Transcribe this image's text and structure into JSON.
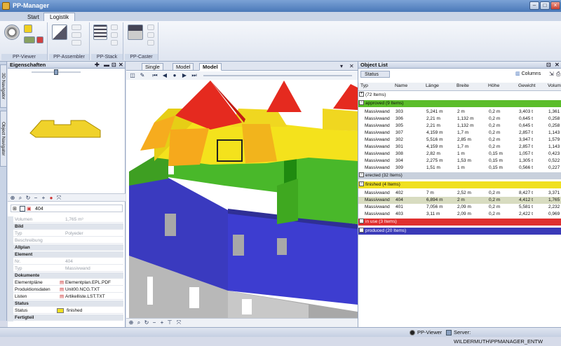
{
  "window": {
    "title": "PP-Manager"
  },
  "ribbon": {
    "tabs": [
      "Start",
      "Logistik"
    ],
    "groups": [
      "PP-Viewer",
      "PP-Assembler",
      "PP-Stack",
      "PP-Caster"
    ]
  },
  "side_tabs": [
    "3D Navigator",
    "Object Navigator"
  ],
  "properties": {
    "title": "Eigenschaften",
    "tree_item": "404",
    "rows": [
      {
        "k": "Volumen",
        "v": "1,765 m³",
        "type": "dim"
      },
      {
        "k": "Bild",
        "v": "",
        "type": "cat"
      },
      {
        "k": "Typ",
        "v": "Polyeder",
        "type": "dim"
      },
      {
        "k": "Beschreibung",
        "v": "",
        "type": "dim"
      },
      {
        "k": "Allplan",
        "v": "",
        "type": "cat"
      },
      {
        "k": "Element",
        "v": "",
        "type": "cat"
      },
      {
        "k": "Nr.",
        "v": "404",
        "type": "dim"
      },
      {
        "k": "Typ",
        "v": "Massivwand",
        "type": "dim"
      },
      {
        "k": "Dokumente",
        "v": "",
        "type": "cat"
      },
      {
        "k": "Elementpläne",
        "v": "Elementplan.EPL.PDF",
        "type": "doc"
      },
      {
        "k": "Produktionsdaten",
        "v": "Unit00.NCG.TXT",
        "type": "doc"
      },
      {
        "k": "Listen",
        "v": "Artikelliste.LST.TXT",
        "type": "doc"
      },
      {
        "k": "Status",
        "v": "",
        "type": "cat"
      },
      {
        "k": "Status",
        "v": "finished",
        "type": "status"
      },
      {
        "k": "Fertigteil",
        "v": "",
        "type": "cat"
      }
    ]
  },
  "viewer": {
    "tabs": [
      "Single",
      "Model",
      "Model"
    ]
  },
  "object_list": {
    "title": "Object List",
    "group_by": "Status",
    "columns_btn": "Columns",
    "headers": [
      "Typ",
      "Name",
      "Länge",
      "Breite",
      "Höhe",
      "Gewicht",
      "Volum"
    ],
    "total": "(72 Items)",
    "groups": [
      {
        "label": "approved (9 Items)",
        "color": "#5bbd2a",
        "rows": [
          [
            "Massivwand",
            "303",
            "5,241 m",
            "2 m",
            "0,2 m",
            "3,403 t",
            "1,361"
          ],
          [
            "Massivwand",
            "306",
            "2,21 m",
            "1,132 m",
            "0,2 m",
            "0,645 t",
            "0,258"
          ],
          [
            "Massivwand",
            "305",
            "2,21 m",
            "1,132 m",
            "0,2 m",
            "0,645 t",
            "0,258"
          ],
          [
            "Massivwand",
            "307",
            "4,159 m",
            "1,7 m",
            "0,2 m",
            "2,857 t",
            "1,143"
          ],
          [
            "Massivwand",
            "302",
            "5,516 m",
            "2,85 m",
            "0,2 m",
            "3,947 t",
            "1,579"
          ],
          [
            "Massivwand",
            "301",
            "4,159 m",
            "1,7 m",
            "0,2 m",
            "2,857 t",
            "1,143"
          ],
          [
            "Massivwand",
            "308",
            "2,82 m",
            "1 m",
            "0,15 m",
            "1,057 t",
            "0,423"
          ],
          [
            "Massivwand",
            "304",
            "2,275 m",
            "1,53 m",
            "0,15 m",
            "1,305 t",
            "0,522"
          ],
          [
            "Massivwand",
            "309",
            "1,51 m",
            "1 m",
            "0,15 m",
            "0,566 t",
            "0,227"
          ]
        ]
      },
      {
        "label": "erected (32 Items)",
        "color": "#c8d0dc",
        "rows": []
      },
      {
        "label": "finished (4 Items)",
        "color": "#f0e020",
        "rows": [
          [
            "Massivwand",
            "402",
            "7 m",
            "2,52 m",
            "0,2 m",
            "8,427 t",
            "3,371"
          ],
          [
            "Massivwand",
            "404",
            "6,894 m",
            "2 m",
            "0,2 m",
            "4,412 t",
            "1,765"
          ],
          [
            "Massivwand",
            "401",
            "7,056 m",
            "2,09 m",
            "0,2 m",
            "5,581 t",
            "2,232"
          ],
          [
            "Massivwand",
            "403",
            "3,11 m",
            "2,09 m",
            "0,2 m",
            "2,422 t",
            "0,969"
          ]
        ]
      },
      {
        "label": "in use (3 Items)",
        "color": "#e03030",
        "rows": []
      },
      {
        "label": "produced (20 Items)",
        "color": "#3a3ab8",
        "rows": []
      }
    ]
  },
  "status_bar": {
    "viewer": "PP-Viewer",
    "server": "Server: WILDERMUTH\\PPMANAGER_ENTW"
  }
}
